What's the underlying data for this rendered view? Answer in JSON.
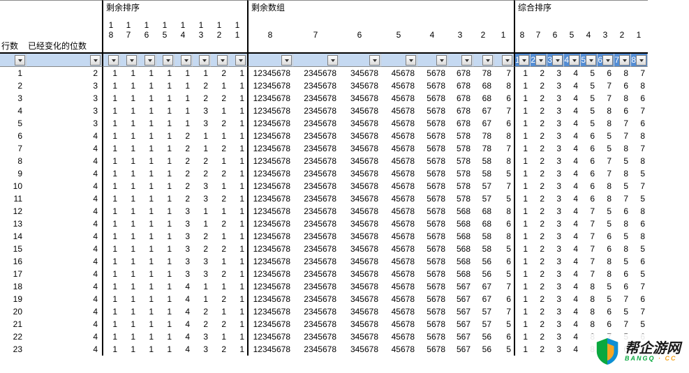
{
  "headers": {
    "section1": "剩余排序",
    "section2": "剩余数组",
    "section3": "综合排序",
    "row_label": "行数",
    "changes_label": "已经变化的位数",
    "seq_cols": [
      "18",
      "17",
      "16",
      "15",
      "14",
      "13",
      "12",
      "11"
    ],
    "group_cols": [
      "8",
      "7",
      "6",
      "5",
      "4",
      "3",
      "2",
      "1"
    ],
    "comp_cols": [
      "8",
      "7",
      "6",
      "5",
      "4",
      "3",
      "2",
      "1"
    ]
  },
  "filter_selected_comp": [
    "1",
    "2",
    "3",
    "4",
    "5",
    "6",
    "7",
    "8"
  ],
  "rows": [
    {
      "idx": 1,
      "chg": 2,
      "seq": [
        1,
        1,
        1,
        1,
        1,
        1,
        2,
        1
      ],
      "grp": [
        "12345678",
        "2345678",
        "345678",
        "45678",
        "5678",
        "678",
        "78",
        "7"
      ],
      "comp": [
        1,
        2,
        3,
        4,
        5,
        6,
        8,
        7
      ]
    },
    {
      "idx": 2,
      "chg": 3,
      "seq": [
        1,
        1,
        1,
        1,
        1,
        2,
        1,
        1
      ],
      "grp": [
        "12345678",
        "2345678",
        "345678",
        "45678",
        "5678",
        "678",
        "68",
        "8"
      ],
      "comp": [
        1,
        2,
        3,
        4,
        5,
        7,
        6,
        8
      ]
    },
    {
      "idx": 3,
      "chg": 3,
      "seq": [
        1,
        1,
        1,
        1,
        1,
        2,
        2,
        1
      ],
      "grp": [
        "12345678",
        "2345678",
        "345678",
        "45678",
        "5678",
        "678",
        "68",
        "6"
      ],
      "comp": [
        1,
        2,
        3,
        4,
        5,
        7,
        8,
        6
      ]
    },
    {
      "idx": 4,
      "chg": 3,
      "seq": [
        1,
        1,
        1,
        1,
        1,
        3,
        1,
        1
      ],
      "grp": [
        "12345678",
        "2345678",
        "345678",
        "45678",
        "5678",
        "678",
        "67",
        "7"
      ],
      "comp": [
        1,
        2,
        3,
        4,
        5,
        8,
        6,
        7
      ]
    },
    {
      "idx": 5,
      "chg": 3,
      "seq": [
        1,
        1,
        1,
        1,
        1,
        3,
        2,
        1
      ],
      "grp": [
        "12345678",
        "2345678",
        "345678",
        "45678",
        "5678",
        "678",
        "67",
        "6"
      ],
      "comp": [
        1,
        2,
        3,
        4,
        5,
        8,
        7,
        6
      ]
    },
    {
      "idx": 6,
      "chg": 4,
      "seq": [
        1,
        1,
        1,
        1,
        2,
        1,
        1,
        1
      ],
      "grp": [
        "12345678",
        "2345678",
        "345678",
        "45678",
        "5678",
        "578",
        "78",
        "8"
      ],
      "comp": [
        1,
        2,
        3,
        4,
        6,
        5,
        7,
        8
      ]
    },
    {
      "idx": 7,
      "chg": 4,
      "seq": [
        1,
        1,
        1,
        1,
        2,
        1,
        2,
        1
      ],
      "grp": [
        "12345678",
        "2345678",
        "345678",
        "45678",
        "5678",
        "578",
        "78",
        "7"
      ],
      "comp": [
        1,
        2,
        3,
        4,
        6,
        5,
        8,
        7
      ]
    },
    {
      "idx": 8,
      "chg": 4,
      "seq": [
        1,
        1,
        1,
        1,
        2,
        2,
        1,
        1
      ],
      "grp": [
        "12345678",
        "2345678",
        "345678",
        "45678",
        "5678",
        "578",
        "58",
        "8"
      ],
      "comp": [
        1,
        2,
        3,
        4,
        6,
        7,
        5,
        8
      ]
    },
    {
      "idx": 9,
      "chg": 4,
      "seq": [
        1,
        1,
        1,
        1,
        2,
        2,
        2,
        1
      ],
      "grp": [
        "12345678",
        "2345678",
        "345678",
        "45678",
        "5678",
        "578",
        "58",
        "5"
      ],
      "comp": [
        1,
        2,
        3,
        4,
        6,
        7,
        8,
        5
      ]
    },
    {
      "idx": 10,
      "chg": 4,
      "seq": [
        1,
        1,
        1,
        1,
        2,
        3,
        1,
        1
      ],
      "grp": [
        "12345678",
        "2345678",
        "345678",
        "45678",
        "5678",
        "578",
        "57",
        "7"
      ],
      "comp": [
        1,
        2,
        3,
        4,
        6,
        8,
        5,
        7
      ]
    },
    {
      "idx": 11,
      "chg": 4,
      "seq": [
        1,
        1,
        1,
        1,
        2,
        3,
        2,
        1
      ],
      "grp": [
        "12345678",
        "2345678",
        "345678",
        "45678",
        "5678",
        "578",
        "57",
        "5"
      ],
      "comp": [
        1,
        2,
        3,
        4,
        6,
        8,
        7,
        5
      ]
    },
    {
      "idx": 12,
      "chg": 4,
      "seq": [
        1,
        1,
        1,
        1,
        3,
        1,
        1,
        1
      ],
      "grp": [
        "12345678",
        "2345678",
        "345678",
        "45678",
        "5678",
        "568",
        "68",
        "8"
      ],
      "comp": [
        1,
        2,
        3,
        4,
        7,
        5,
        6,
        8
      ]
    },
    {
      "idx": 13,
      "chg": 4,
      "seq": [
        1,
        1,
        1,
        1,
        3,
        1,
        2,
        1
      ],
      "grp": [
        "12345678",
        "2345678",
        "345678",
        "45678",
        "5678",
        "568",
        "68",
        "6"
      ],
      "comp": [
        1,
        2,
        3,
        4,
        7,
        5,
        8,
        6
      ]
    },
    {
      "idx": 14,
      "chg": 4,
      "seq": [
        1,
        1,
        1,
        1,
        3,
        2,
        1,
        1
      ],
      "grp": [
        "12345678",
        "2345678",
        "345678",
        "45678",
        "5678",
        "568",
        "58",
        "8"
      ],
      "comp": [
        1,
        2,
        3,
        4,
        7,
        6,
        5,
        8
      ]
    },
    {
      "idx": 15,
      "chg": 4,
      "seq": [
        1,
        1,
        1,
        1,
        3,
        2,
        2,
        1
      ],
      "grp": [
        "12345678",
        "2345678",
        "345678",
        "45678",
        "5678",
        "568",
        "58",
        "5"
      ],
      "comp": [
        1,
        2,
        3,
        4,
        7,
        6,
        8,
        5
      ]
    },
    {
      "idx": 16,
      "chg": 4,
      "seq": [
        1,
        1,
        1,
        1,
        3,
        3,
        1,
        1
      ],
      "grp": [
        "12345678",
        "2345678",
        "345678",
        "45678",
        "5678",
        "568",
        "56",
        "6"
      ],
      "comp": [
        1,
        2,
        3,
        4,
        7,
        8,
        5,
        6
      ]
    },
    {
      "idx": 17,
      "chg": 4,
      "seq": [
        1,
        1,
        1,
        1,
        3,
        3,
        2,
        1
      ],
      "grp": [
        "12345678",
        "2345678",
        "345678",
        "45678",
        "5678",
        "568",
        "56",
        "5"
      ],
      "comp": [
        1,
        2,
        3,
        4,
        7,
        8,
        6,
        5
      ]
    },
    {
      "idx": 18,
      "chg": 4,
      "seq": [
        1,
        1,
        1,
        1,
        4,
        1,
        1,
        1
      ],
      "grp": [
        "12345678",
        "2345678",
        "345678",
        "45678",
        "5678",
        "567",
        "67",
        "7"
      ],
      "comp": [
        1,
        2,
        3,
        4,
        8,
        5,
        6,
        7
      ]
    },
    {
      "idx": 19,
      "chg": 4,
      "seq": [
        1,
        1,
        1,
        1,
        4,
        1,
        2,
        1
      ],
      "grp": [
        "12345678",
        "2345678",
        "345678",
        "45678",
        "5678",
        "567",
        "67",
        "6"
      ],
      "comp": [
        1,
        2,
        3,
        4,
        8,
        5,
        7,
        6
      ]
    },
    {
      "idx": 20,
      "chg": 4,
      "seq": [
        1,
        1,
        1,
        1,
        4,
        2,
        1,
        1
      ],
      "grp": [
        "12345678",
        "2345678",
        "345678",
        "45678",
        "5678",
        "567",
        "57",
        "7"
      ],
      "comp": [
        1,
        2,
        3,
        4,
        8,
        6,
        5,
        7
      ]
    },
    {
      "idx": 21,
      "chg": 4,
      "seq": [
        1,
        1,
        1,
        1,
        4,
        2,
        2,
        1
      ],
      "grp": [
        "12345678",
        "2345678",
        "345678",
        "45678",
        "5678",
        "567",
        "57",
        "5"
      ],
      "comp": [
        1,
        2,
        3,
        4,
        8,
        6,
        7,
        5
      ]
    },
    {
      "idx": 22,
      "chg": 4,
      "seq": [
        1,
        1,
        1,
        1,
        4,
        3,
        1,
        1
      ],
      "grp": [
        "12345678",
        "2345678",
        "345678",
        "45678",
        "5678",
        "567",
        "56",
        "6"
      ],
      "comp": [
        1,
        2,
        3,
        4,
        8,
        7,
        5,
        6
      ]
    },
    {
      "idx": 23,
      "chg": 4,
      "seq": [
        1,
        1,
        1,
        1,
        4,
        3,
        2,
        1
      ],
      "grp": [
        "12345678",
        "2345678",
        "345678",
        "45678",
        "5678",
        "567",
        "56",
        "5"
      ],
      "comp": [
        1,
        2,
        3,
        4,
        8,
        7,
        6,
        5
      ]
    }
  ],
  "logo": {
    "cn": "帮企游网",
    "en_a": "BANGQ",
    "en_b": "CC"
  }
}
